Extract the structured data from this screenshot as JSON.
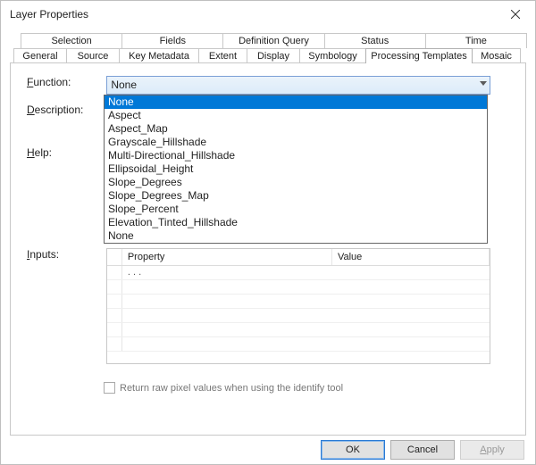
{
  "window": {
    "title": "Layer Properties"
  },
  "tabs": {
    "row1": [
      "Selection",
      "Fields",
      "Definition Query",
      "Status",
      "Time"
    ],
    "row2": [
      "General",
      "Source",
      "Key Metadata",
      "Extent",
      "Display",
      "Symbology",
      "Processing Templates",
      "Mosaic"
    ],
    "selected": "Processing Templates"
  },
  "form": {
    "function_label": "Function:",
    "function_value": "None",
    "description_label": "Description:",
    "help_label": "Help:",
    "inputs_label": "Inputs:",
    "inputs_headers": {
      "property": "Property",
      "value": "Value"
    },
    "inputs_placeholder": ". . .",
    "return_raw_label": "Return raw pixel values when using the identify tool",
    "return_raw_checked": false
  },
  "dropdown": {
    "options": [
      "None",
      "Aspect",
      "Aspect_Map",
      "Grayscale_Hillshade",
      "Multi-Directional_Hillshade",
      "Ellipsoidal_Height",
      "Slope_Degrees",
      "Slope_Degrees_Map",
      "Slope_Percent",
      "Elevation_Tinted_Hillshade",
      "None"
    ],
    "selected_index": 0
  },
  "buttons": {
    "ok": "OK",
    "cancel": "Cancel",
    "apply": "Apply"
  }
}
